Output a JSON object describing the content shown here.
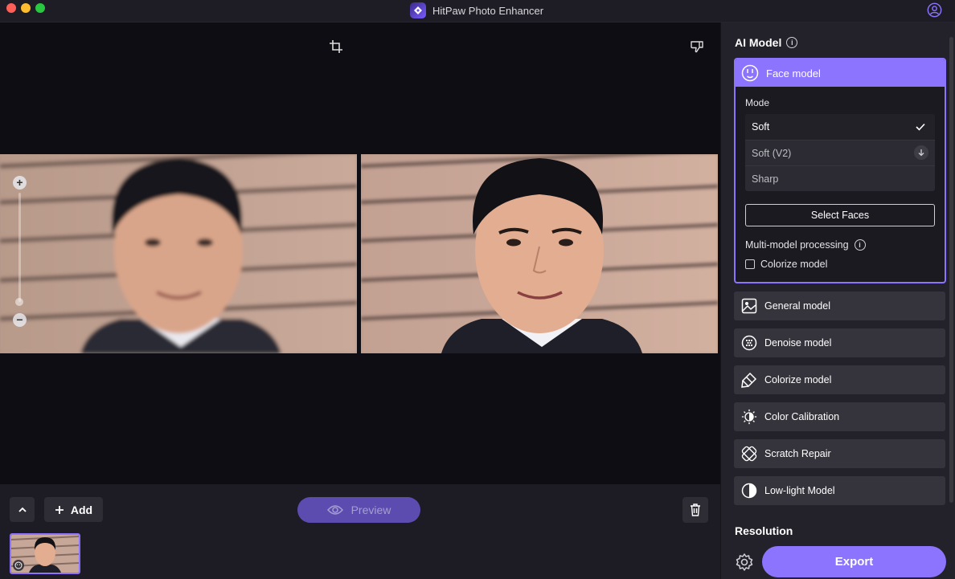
{
  "window": {
    "title": "HitPaw Photo Enhancer"
  },
  "canvas": {
    "tools": [
      "crop-icon",
      "dislike-icon"
    ],
    "zoom": {
      "plus": "+",
      "minus": "−"
    }
  },
  "bottombar": {
    "add_label": "Add",
    "preview_label": "Preview"
  },
  "panel": {
    "ai_model_heading": "AI Model",
    "face_model": {
      "label": "Face model",
      "mode_label": "Mode",
      "modes": [
        {
          "label": "Soft",
          "selected": true
        },
        {
          "label": "Soft (V2)",
          "selected": false,
          "needs_download": true
        },
        {
          "label": "Sharp",
          "selected": false
        }
      ],
      "select_faces_label": "Select Faces",
      "multi_model_label": "Multi-model processing",
      "colorize_checkbox_label": "Colorize model",
      "colorize_checked": false
    },
    "models": [
      {
        "label": "General model",
        "icon": "image-icon"
      },
      {
        "label": "Denoise model",
        "icon": "denoise-icon"
      },
      {
        "label": "Colorize model",
        "icon": "paint-brush-icon"
      },
      {
        "label": "Color Calibration",
        "icon": "sun-contrast-icon"
      },
      {
        "label": "Scratch Repair",
        "icon": "bandage-icon"
      },
      {
        "label": "Low-light Model",
        "icon": "half-circle-icon"
      }
    ],
    "resolution_heading": "Resolution",
    "export_label": "Export"
  },
  "colors": {
    "accent": "#8c74ff",
    "panel_bg": "#23222a",
    "canvas_bg": "#0e0d13"
  }
}
